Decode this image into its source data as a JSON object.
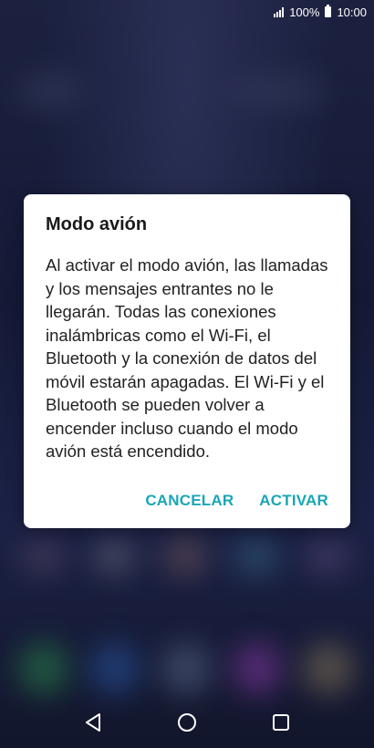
{
  "status_bar": {
    "battery": "100%",
    "time": "10:00"
  },
  "dialog": {
    "title": "Modo avión",
    "message": "Al activar el modo avión, las llamadas y los mensajes entrantes no le llegarán. Todas las conexiones inalámbricas como el Wi-Fi, el Bluetooth y la conexión de datos del móvil estarán apagadas. El Wi-Fi y el Bluetooth se pueden volver a encender incluso cuando el modo avión está encendido.",
    "cancel_label": "CANCELAR",
    "confirm_label": "ACTIVAR"
  },
  "nav_bar": {
    "back_icon": "back-icon",
    "home_icon": "home-icon",
    "recents_icon": "recents-icon"
  },
  "colors": {
    "accent": "#1aa6b7",
    "dialog_bg": "#ffffff"
  }
}
